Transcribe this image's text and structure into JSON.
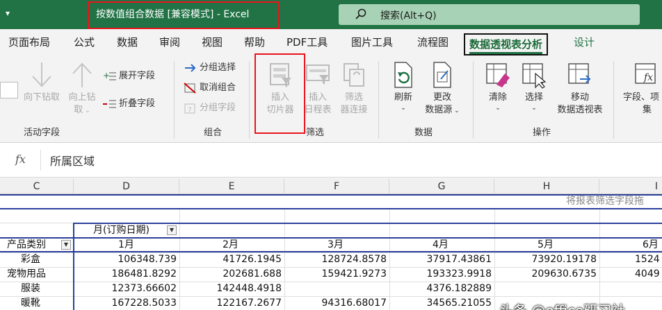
{
  "titlebar": {
    "quick_access": "▾",
    "doc_title": "按数值组合数据 [兼容模式] - Excel",
    "search_text": "搜索(Alt+Q)"
  },
  "tabs": [
    "页面布局",
    "公式",
    "数据",
    "审阅",
    "视图",
    "帮助",
    "PDF工具",
    "图片工具",
    "流程图",
    "数据透视表分析",
    "设计"
  ],
  "ribbon": {
    "active_field": {
      "drill_down": "向下钻取",
      "drill_up_1": "向上钻",
      "drill_up_2": "取",
      "expand": "展开字段",
      "collapse": "折叠字段",
      "label": "活动字段"
    },
    "group": {
      "group_selection": "分组选择",
      "ungroup": "取消组合",
      "group_field": "分组字段",
      "label": "组合"
    },
    "filter": {
      "insert_slicer_1": "插入",
      "insert_slicer_2": "切片器",
      "insert_timeline_1": "插入",
      "insert_timeline_2": "日程表",
      "filter_connections_1": "筛选",
      "filter_connections_2": "器连接",
      "label": "筛选"
    },
    "data": {
      "refresh": "刷新",
      "change_source_1": "更改",
      "change_source_2": "数据源",
      "label": "数据"
    },
    "actions": {
      "clear": "清除",
      "select": "选择",
      "move_1": "移动",
      "move_2": "数据透视表",
      "label": "操作"
    },
    "calc": {
      "fields_1": "字段、项",
      "fields_2": "集"
    }
  },
  "formula": {
    "fx": "fx",
    "content": "所属区域"
  },
  "columns": [
    "C",
    "D",
    "E",
    "F",
    "G",
    "H",
    "I"
  ],
  "pivot": {
    "drop_hint": "将报表筛选字段拖",
    "column_field": "月(订购日期)",
    "row_field": "产品类别",
    "months": [
      "1月",
      "2月",
      "3月",
      "4月",
      "5月",
      "6月"
    ],
    "rows": [
      {
        "category": "彩盒",
        "values": [
          "106348.739",
          "41726.1945",
          "128724.8578",
          "37917.43861",
          "73920.19178",
          "1524"
        ]
      },
      {
        "category": "宠物用品",
        "values": [
          "186481.8292",
          "202681.688",
          "159421.9273",
          "193323.9918",
          "209630.6735",
          "4049"
        ]
      },
      {
        "category": "服装",
        "values": [
          "12373.66602",
          "142448.4918",
          "",
          "4376.182889",
          "",
          ""
        ]
      },
      {
        "category": "暖靴",
        "values": [
          "167228.5033",
          "122167.2677",
          "94316.68017",
          "34565.21055",
          "",
          ""
        ]
      }
    ]
  },
  "watermark": "头条 @office研习社",
  "colors": {
    "brand": "#217346",
    "highlight": "#e8141b",
    "pivot_border": "#2a3f9a"
  }
}
